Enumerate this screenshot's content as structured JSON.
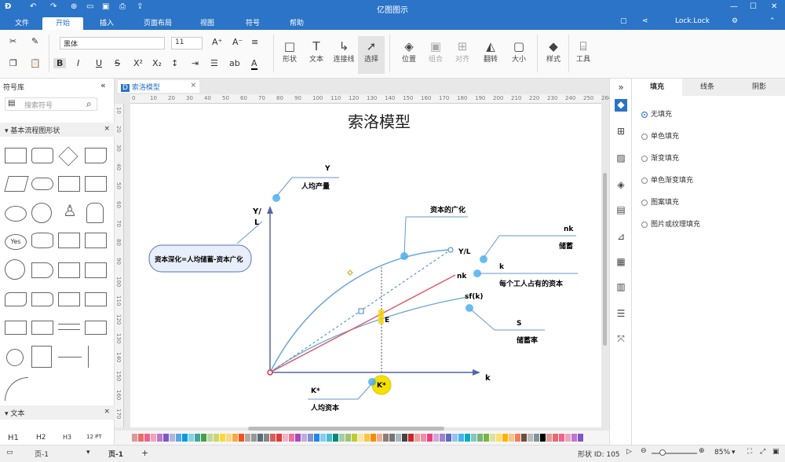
{
  "app_title": "亿图图示",
  "menu": [
    "文件",
    "开始",
    "插入",
    "页面布局",
    "视图",
    "符号",
    "帮助"
  ],
  "user": "Lock.Lock",
  "toolbar": {
    "font": "黑体",
    "size": "11",
    "shape": "形状",
    "text": "文本",
    "connector": "连接线",
    "select": "选择",
    "position": "位置",
    "group": "组合",
    "align": "对齐",
    "flip": "翻转",
    "size_label": "大小",
    "style": "样式",
    "tools": "工具"
  },
  "left": {
    "title": "符号库",
    "search_placeholder": "搜索符号",
    "section1": "基本流程图形状",
    "section2": "文本",
    "yes": "Yes",
    "text_samples": [
      "H1",
      "H2",
      "H3",
      "12 PT"
    ]
  },
  "doc_tab": "索洛模型",
  "ruler_h": [
    "0",
    "10",
    "20",
    "30",
    "40",
    "50",
    "60",
    "70",
    "80",
    "90",
    "100",
    "110",
    "120",
    "130",
    "140",
    "150",
    "160",
    "170",
    "180",
    "190",
    "200",
    "210",
    "220",
    "230",
    "240",
    "250",
    "260"
  ],
  "ruler_v": [
    "10",
    "20",
    "30",
    "40",
    "50",
    "60",
    "70",
    "80",
    "90",
    "100",
    "110",
    "120",
    "130",
    "140",
    "150",
    "160",
    "170"
  ],
  "diagram": {
    "title": "索洛模型",
    "y_label_1": "Y/",
    "y_label_2": "L",
    "x_label": "k",
    "y_tag": "Y",
    "y_desc": "人均产量",
    "capital_widening": "资本的广化",
    "deepening": "资本深化=人均储蓄-资本广化",
    "yl": "Y/L",
    "nk_tag": "nk",
    "nk_desc": "储蓄",
    "nk_line": "nk",
    "k_tag": "k",
    "k_desc": "每个工人占有的资本",
    "sfk": "sf(k)",
    "s_tag": "S",
    "s_desc": "储蓄率",
    "e_label": "E",
    "kstar": "K*",
    "kstar2": "K*",
    "kstar_desc": "人均资本"
  },
  "right": {
    "tabs": [
      "填充",
      "线条",
      "阴影"
    ],
    "options": [
      "无填充",
      "单色填充",
      "渐变填充",
      "单色渐变填充",
      "图案填充",
      "图片或纹理填充"
    ]
  },
  "status": {
    "page1": "页-1",
    "page_tab": "页-1",
    "shape_id": "形状 ID: 105",
    "zoom": "85%"
  }
}
